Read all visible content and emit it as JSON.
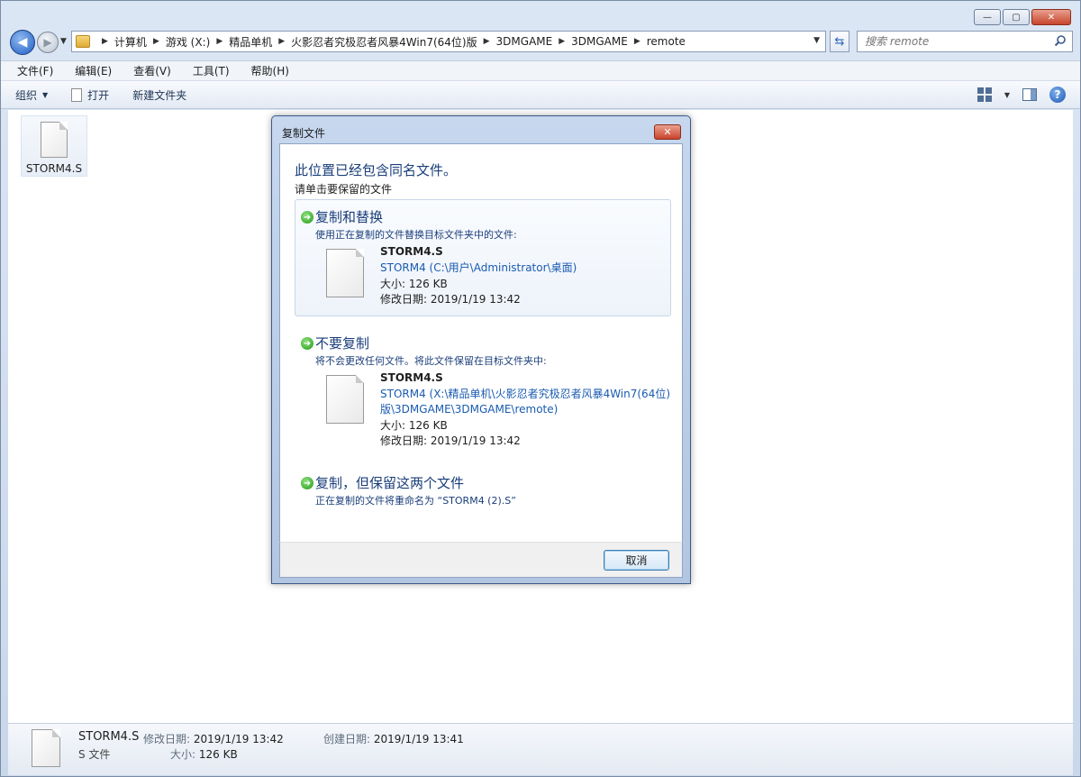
{
  "window": {
    "controls": {
      "minimize": "—",
      "maximize": "▢",
      "close": "✕"
    }
  },
  "nav": {
    "back_glyph": "◀",
    "forward_glyph": "▶",
    "breadcrumb": [
      "计算机",
      "游戏 (X:)",
      "精品单机",
      "火影忍者究极忍者风暴4Win7(64位)版",
      "3DMGAME",
      "3DMGAME",
      "remote"
    ],
    "search_placeholder": "搜索 remote"
  },
  "menu": [
    "文件(F)",
    "编辑(E)",
    "查看(V)",
    "工具(T)",
    "帮助(H)"
  ],
  "toolbar": {
    "organize": "组织",
    "open": "打开",
    "new_folder": "新建文件夹"
  },
  "content": {
    "files": [
      {
        "name": "STORM4.S"
      }
    ]
  },
  "details": {
    "name": "STORM4.S",
    "type": "S 文件",
    "modified_label": "修改日期:",
    "modified": "2019/1/19 13:42",
    "size_label": "大小:",
    "size": "126 KB",
    "created_label": "创建日期:",
    "created": "2019/1/19 13:41"
  },
  "dialog": {
    "title": "复制文件",
    "close": "✕",
    "heading": "此位置已经包含同名文件。",
    "sub": "请单击要保留的文件",
    "options": [
      {
        "title": "复制和替换",
        "desc": "使用正在复制的文件替换目标文件夹中的文件:",
        "file_name": "STORM4.S",
        "file_path": "STORM4 (C:\\用户\\Administrator\\桌面)",
        "size": "大小: 126 KB",
        "modified": "修改日期: 2019/1/19 13:42"
      },
      {
        "title": "不要复制",
        "desc": "将不会更改任何文件。将此文件保留在目标文件夹中:",
        "file_name": "STORM4.S",
        "file_path": "STORM4 (X:\\精品单机\\火影忍者究极忍者风暴4Win7(64位)版\\3DMGAME\\3DMGAME\\remote)",
        "size": "大小: 126 KB",
        "modified": "修改日期: 2019/1/19 13:42"
      },
      {
        "title": "复制，但保留这两个文件",
        "desc": "正在复制的文件将重命名为 “STORM4 (2).S”"
      }
    ],
    "cancel": "取消"
  }
}
